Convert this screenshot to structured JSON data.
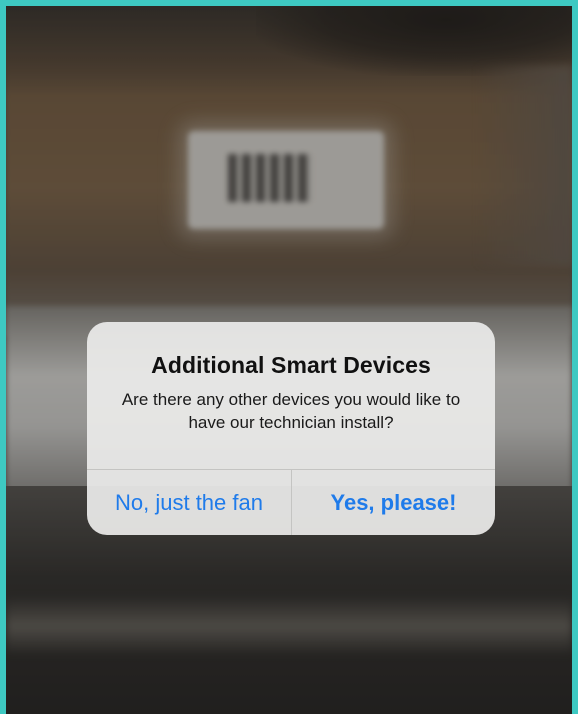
{
  "alert": {
    "title": "Additional Smart Devices",
    "message": "Are there any other devices you would like to have our technician install?",
    "buttons": {
      "no_label": "No, just the fan",
      "yes_label": "Yes, please!"
    }
  },
  "colors": {
    "border": "#3ec9c2",
    "button_text": "#1f7bea",
    "alert_background": "#ebebe9"
  }
}
